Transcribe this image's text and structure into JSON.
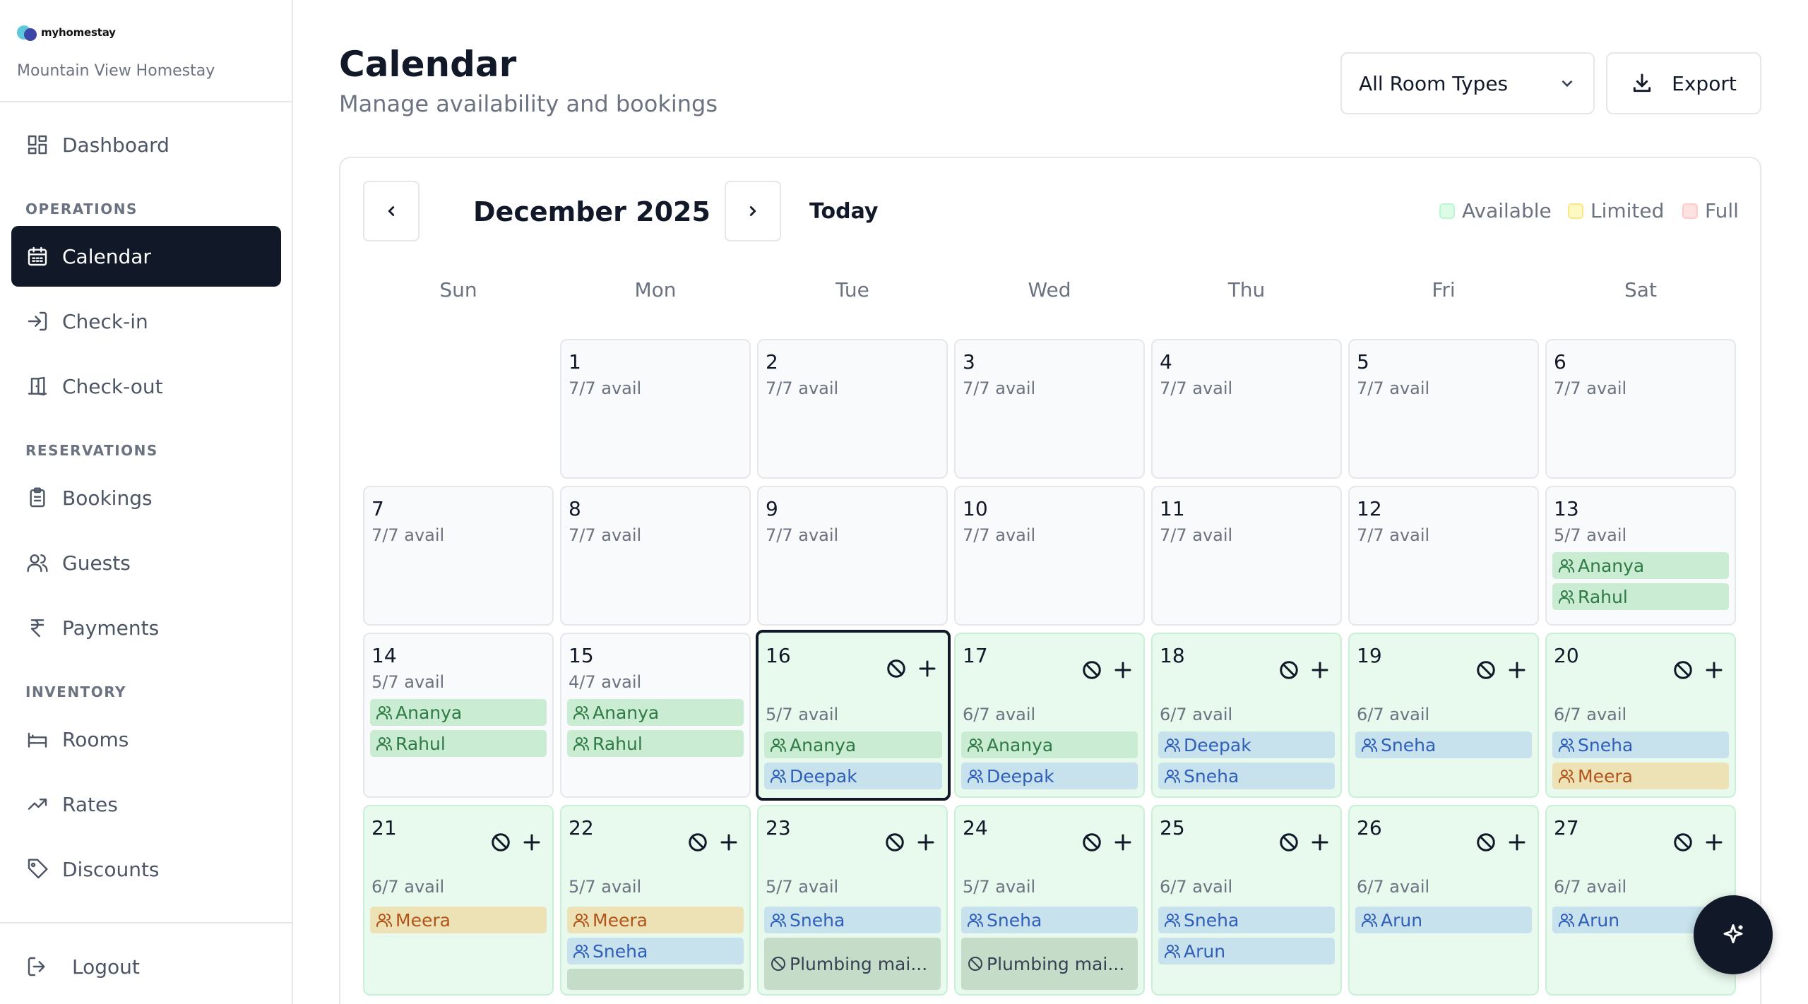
{
  "brand": {
    "name": "myhomestay",
    "property": "Mountain View Homestay"
  },
  "sidebar": {
    "dashboard": "Dashboard",
    "operations_label": "OPERATIONS",
    "calendar": "Calendar",
    "checkin": "Check-in",
    "checkout": "Check-out",
    "reservations_label": "RESERVATIONS",
    "bookings": "Bookings",
    "guests": "Guests",
    "payments": "Payments",
    "inventory_label": "INVENTORY",
    "rooms": "Rooms",
    "rates": "Rates",
    "discounts": "Discounts",
    "logout": "Logout"
  },
  "header": {
    "title": "Calendar",
    "subtitle": "Manage availability and bookings",
    "room_filter": "All Room Types",
    "export_label": "Export"
  },
  "calendar": {
    "month": "December 2025",
    "today_label": "Today",
    "legend": {
      "available": "Available",
      "limited": "Limited",
      "full": "Full"
    },
    "weekdays": [
      "Sun",
      "Mon",
      "Tue",
      "Wed",
      "Thu",
      "Fri",
      "Sat"
    ],
    "days": [
      {
        "num": "1",
        "avail": "7/7 avail",
        "chips": []
      },
      {
        "num": "2",
        "avail": "7/7 avail",
        "chips": []
      },
      {
        "num": "3",
        "avail": "7/7 avail",
        "chips": []
      },
      {
        "num": "4",
        "avail": "7/7 avail",
        "chips": []
      },
      {
        "num": "5",
        "avail": "7/7 avail",
        "chips": []
      },
      {
        "num": "6",
        "avail": "7/7 avail",
        "chips": []
      },
      {
        "num": "7",
        "avail": "7/7 avail",
        "chips": []
      },
      {
        "num": "8",
        "avail": "7/7 avail",
        "chips": []
      },
      {
        "num": "9",
        "avail": "7/7 avail",
        "chips": []
      },
      {
        "num": "10",
        "avail": "7/7 avail",
        "chips": []
      },
      {
        "num": "11",
        "avail": "7/7 avail",
        "chips": []
      },
      {
        "num": "12",
        "avail": "7/7 avail",
        "chips": []
      },
      {
        "num": "13",
        "avail": "5/7 avail",
        "chips": [
          {
            "label": "Ananya"
          },
          {
            "label": "Rahul"
          }
        ]
      },
      {
        "num": "14",
        "avail": "5/7 avail",
        "chips": [
          {
            "label": "Ananya"
          },
          {
            "label": "Rahul"
          }
        ]
      },
      {
        "num": "15",
        "avail": "4/7 avail",
        "chips": [
          {
            "label": "Ananya"
          },
          {
            "label": "Rahul"
          }
        ]
      },
      {
        "num": "16",
        "avail": "5/7 avail",
        "chips": [
          {
            "label": "Ananya"
          },
          {
            "label": "Deepak"
          }
        ]
      },
      {
        "num": "17",
        "avail": "6/7 avail",
        "chips": [
          {
            "label": "Ananya"
          },
          {
            "label": "Deepak"
          }
        ]
      },
      {
        "num": "18",
        "avail": "6/7 avail",
        "chips": [
          {
            "label": "Deepak"
          },
          {
            "label": "Sneha"
          }
        ]
      },
      {
        "num": "19",
        "avail": "6/7 avail",
        "chips": [
          {
            "label": "Sneha"
          }
        ]
      },
      {
        "num": "20",
        "avail": "6/7 avail",
        "chips": [
          {
            "label": "Sneha"
          },
          {
            "label": "Meera"
          }
        ]
      },
      {
        "num": "21",
        "avail": "6/7 avail",
        "chips": [
          {
            "label": "Meera"
          }
        ]
      },
      {
        "num": "22",
        "avail": "5/7 avail",
        "chips": [
          {
            "label": "Meera"
          },
          {
            "label": "Sneha"
          },
          {
            "label": ""
          }
        ]
      },
      {
        "num": "23",
        "avail": "5/7 avail",
        "chips": [
          {
            "label": "Sneha"
          },
          {
            "label": "Plumbing mai..."
          }
        ]
      },
      {
        "num": "24",
        "avail": "5/7 avail",
        "chips": [
          {
            "label": "Sneha"
          },
          {
            "label": "Plumbing mai..."
          }
        ]
      },
      {
        "num": "25",
        "avail": "6/7 avail",
        "chips": [
          {
            "label": "Sneha"
          },
          {
            "label": "Arun"
          }
        ]
      },
      {
        "num": "26",
        "avail": "6/7 avail",
        "chips": [
          {
            "label": "Arun"
          }
        ]
      },
      {
        "num": "27",
        "avail": "6/7 avail",
        "chips": [
          {
            "label": "Arun"
          }
        ]
      }
    ]
  },
  "colors": {
    "primary": "#111827",
    "available": "#e8faee",
    "limited": "#fdf6c6",
    "full": "#fde2e2",
    "chip_green": "#c9ecd2",
    "chip_blue": "#c7e2ec",
    "chip_amber": "#ece2b6"
  }
}
